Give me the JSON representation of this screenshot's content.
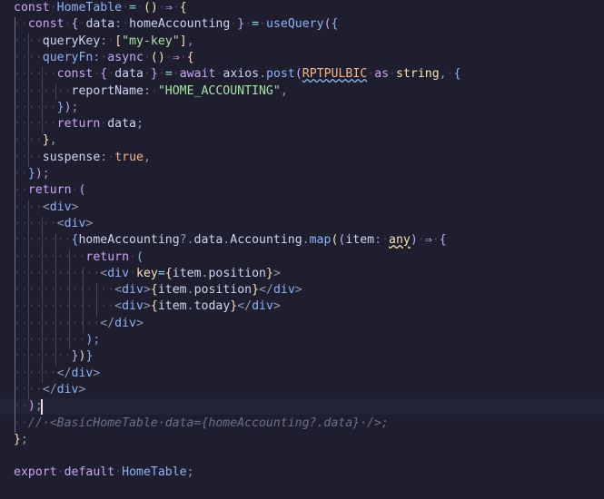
{
  "editor": {
    "language": "typescript",
    "theme_colors": {
      "background": "#1e1e2e",
      "foreground": "#cdd6f4",
      "keyword": "#cba6f7",
      "function": "#89b4fa",
      "string": "#a6e3a1",
      "boolean": "#fab387",
      "comment": "#6c7086"
    },
    "lines": [
      "const HomeTable = () ⇒ {",
      "  const { data: homeAccounting } = useQuery({",
      "    queryKey: [\"my-key\"],",
      "    queryFn: async () ⇒ {",
      "      const { data } = await axios.post(RPTPULBIC as string, {",
      "        reportName: \"HOME_ACCOUNTING\",",
      "      });",
      "      return data;",
      "    },",
      "    suspense: true,",
      "  });",
      "  return (",
      "    <div>",
      "      <div>",
      "        {homeAccounting?.data.Accounting.map((item: any) ⇒ {",
      "          return (",
      "            <div key={item.position}>",
      "              <div>{item.position}</div>",
      "              <div>{item.today}</div>",
      "            </div>",
      "          );",
      "        })}",
      "      </div>",
      "    </div>",
      "  );",
      "  // <BasicHomeTable data={homeAccounting?.data} />;",
      "};",
      "",
      "export default HomeTable;"
    ]
  }
}
